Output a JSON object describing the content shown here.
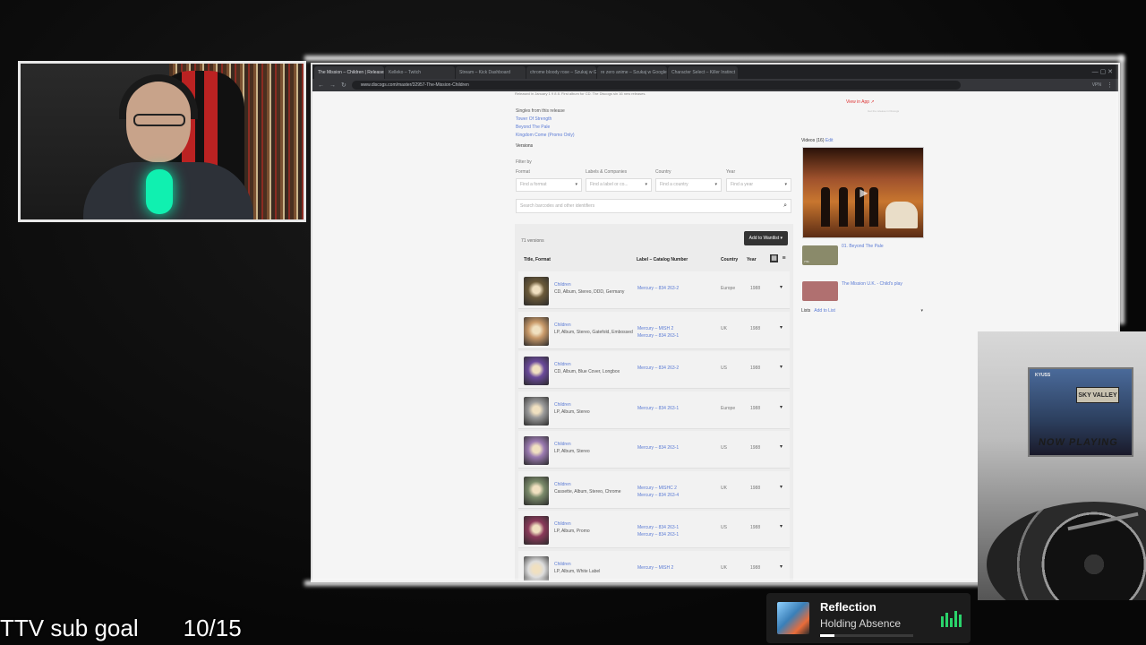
{
  "browser": {
    "tabs": [
      {
        "label": "The Mission – Children | Releases",
        "active": true
      },
      {
        "label": "Kelleko – Twitch",
        "active": false
      },
      {
        "label": "Stream – Kick Dashboard",
        "active": false
      },
      {
        "label": "chrome bloody rose – Szukaj w Google",
        "active": false
      },
      {
        "label": "re zero anime – Szukaj w Google",
        "active": false
      },
      {
        "label": "Character Select – Killer Instinct",
        "active": false
      }
    ],
    "url": "www.discogs.com/master/32957-The-Mission-Children",
    "vpn_label": "VPN"
  },
  "page": {
    "top_note": "Released in January 1 9 8 8. First album for CD. The Discogs sin 16 new releases.",
    "singles_heading": "Singles from this release",
    "singles": [
      "Tower Of Strength",
      "Beyond The Pale",
      "Kingdom Come (Promo Only)"
    ],
    "versions_heading": "Versions",
    "filter_by": "Filter by",
    "filters": [
      {
        "label": "Format",
        "placeholder": "Find a format"
      },
      {
        "label": "Labels & Companies",
        "placeholder": "Find a label or co..."
      },
      {
        "label": "Country",
        "placeholder": "Find a country"
      },
      {
        "label": "Year",
        "placeholder": "Find a year"
      }
    ],
    "search_placeholder": "Search barcodes and other identifiers",
    "version_count": "71 versions",
    "add_to_wantlist": "Add to Wantlist",
    "columns": {
      "title_format": "Title, Format",
      "label_cat": "Label – Catalog Number",
      "country": "Country",
      "year": "Year"
    },
    "rows": [
      {
        "title": "Children",
        "format": "CD, Album, Stereo, DDD, Germany",
        "label": "Mercury – 834 263-2",
        "label2": "",
        "country": "Europe",
        "year": "1988",
        "thumb": "#6b5a3a"
      },
      {
        "title": "Children",
        "format": "LP, Album, Stereo, Gatefold, Embossed",
        "label": "Mercury – MISH 2",
        "label2": "Mercury – 834 263-1",
        "country": "UK",
        "year": "1988",
        "thumb": "#c99a6a"
      },
      {
        "title": "Children",
        "format": "CD, Album, Blue Cover, Longbox",
        "label": "Mercury – 834 263-2",
        "label2": "",
        "country": "US",
        "year": "1988",
        "thumb": "#6a4a9a"
      },
      {
        "title": "Children",
        "format": "LP, Album, Stereo",
        "label": "Mercury – 834 263-1",
        "label2": "",
        "country": "Europe",
        "year": "1988",
        "thumb": "#9a9a9a"
      },
      {
        "title": "Children",
        "format": "LP, Album, Stereo",
        "label": "Mercury – 834 263-1",
        "label2": "",
        "country": "US",
        "year": "1988",
        "thumb": "#9a7ab0"
      },
      {
        "title": "Children",
        "format": "Cassette, Album, Stereo, Chrome",
        "label": "Mercury – MISHC 2",
        "label2": "Mercury – 834 263-4",
        "country": "UK",
        "year": "1988",
        "thumb": "#7a8a6a"
      },
      {
        "title": "Children",
        "format": "LP, Album, Promo",
        "label": "Mercury – 834 263-1",
        "label2": "Mercury – 834 263-1",
        "country": "US",
        "year": "1988",
        "thumb": "#8a3a5a"
      },
      {
        "title": "Children",
        "format": "LP, Album, White Label",
        "label": "Mercury – MISH 2",
        "label2": "",
        "country": "UK",
        "year": "1988",
        "thumb": "#dddddd"
      }
    ],
    "view_in_app": "View in App ↗",
    "view_in_app_sub": "Get the release in Discogs",
    "videos_heading": "Videos (16)",
    "videos_edit": "Edit",
    "videos": [
      {
        "label": "01. Beyond The Pale",
        "duration": "7:51"
      },
      {
        "label": "The Mission U.K. - Child's play",
        "duration": ""
      }
    ],
    "lists_label": "Lists",
    "lists_add": "Add to List"
  },
  "now_playing": {
    "title": "Reflection",
    "artist": "Holding Absence",
    "progress": 0.15,
    "accent": "#2ad46b"
  },
  "album_cam": {
    "band": "KYUSS",
    "sign": "SKY VALLEY",
    "caption": "NOW PLAYING"
  },
  "sub_goal": {
    "label": "TTV sub goal",
    "count": "10/15",
    "progress": 0.6667
  }
}
